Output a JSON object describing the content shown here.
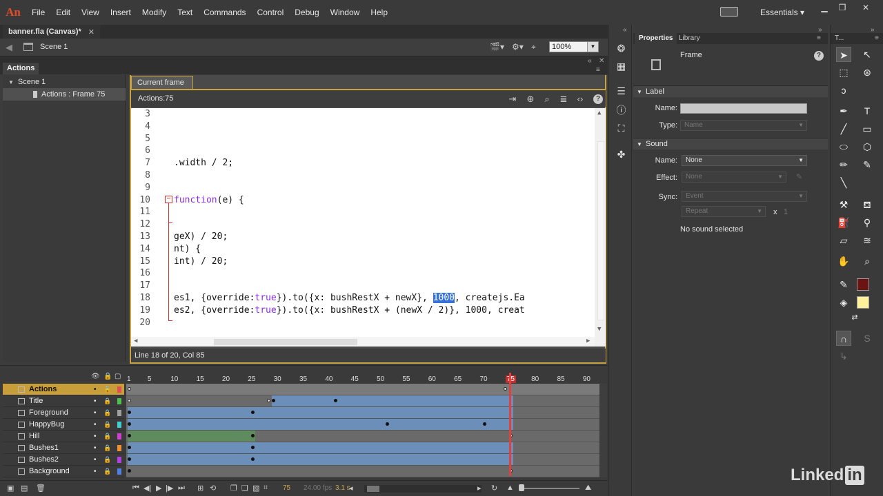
{
  "app": {
    "logo": "An"
  },
  "menu": [
    "File",
    "Edit",
    "View",
    "Insert",
    "Modify",
    "Text",
    "Commands",
    "Control",
    "Debug",
    "Window",
    "Help"
  ],
  "workspace": {
    "label": "Essentials"
  },
  "document": {
    "tab_title": "banner.fla (Canvas)*",
    "scene": "Scene 1",
    "zoom": "100%"
  },
  "actions_panel": {
    "tab_title": "Actions",
    "nav": {
      "scene": "Scene 1",
      "frame": "Actions : Frame 75"
    },
    "editor_tab": "Current frame",
    "editor_label": "Actions:75",
    "status": "Line 18 of 20, Col 85",
    "code_lines": [
      {
        "num": "3",
        "text": ""
      },
      {
        "num": "4",
        "text": ""
      },
      {
        "num": "5",
        "text": ""
      },
      {
        "num": "6",
        "text": ""
      },
      {
        "num": "7",
        "text": ".width / 2;"
      },
      {
        "num": "8",
        "text": ""
      },
      {
        "num": "9",
        "text": ""
      },
      {
        "num": "10",
        "kw": "function",
        "rest": "(e) {"
      },
      {
        "num": "11",
        "text": ""
      },
      {
        "num": "12",
        "text": ""
      },
      {
        "num": "13",
        "text": "geX) / 20;"
      },
      {
        "num": "14",
        "text": "nt) {"
      },
      {
        "num": "15",
        "text": "int) / 20;"
      },
      {
        "num": "16",
        "text": ""
      },
      {
        "num": "17",
        "text": ""
      },
      {
        "num": "18",
        "pre": "es1, {override:",
        "kw": "true",
        "mid": "}).to({x: bushRestX + newX}, ",
        "sel": "1000",
        "post": ", createjs.Ea"
      },
      {
        "num": "19",
        "pre": "es2, {override:",
        "kw": "true",
        "mid": "}).to({x: bushRestX + (newX / 2)}, 1000, creat",
        "sel": "",
        "post": ""
      },
      {
        "num": "20",
        "text": ""
      }
    ]
  },
  "properties": {
    "tabs": [
      "Properties",
      "Library"
    ],
    "object_type": "Frame",
    "label_section": "Label",
    "name_label": "Name:",
    "type_label": "Type:",
    "type_value": "Name",
    "sound_section": "Sound",
    "sound_name_label": "Name:",
    "sound_name_value": "None",
    "effect_label": "Effect:",
    "effect_value": "None",
    "sync_label": "Sync:",
    "sync_value": "Event",
    "repeat_value": "Repeat",
    "repeat_x": "x",
    "repeat_count": "1",
    "no_sound": "No sound selected"
  },
  "tools_header": "T...",
  "timeline": {
    "ruler": [
      "1",
      "5",
      "10",
      "15",
      "20",
      "25",
      "30",
      "35",
      "40",
      "45",
      "50",
      "55",
      "60",
      "65",
      "70",
      "75",
      "80",
      "85",
      "90"
    ],
    "current_frame": "75",
    "layers": [
      {
        "name": "Actions",
        "color": "#e05050",
        "active": true
      },
      {
        "name": "Title",
        "color": "#4fbf4f"
      },
      {
        "name": "Foreground",
        "color": "#a0a0a0"
      },
      {
        "name": "HappyBug",
        "color": "#3fcfcf"
      },
      {
        "name": "Hill",
        "color": "#d040d0"
      },
      {
        "name": "Bushes1",
        "color": "#f09030"
      },
      {
        "name": "Bushes2",
        "color": "#b040e0"
      },
      {
        "name": "Background",
        "color": "#5080e0"
      }
    ],
    "footer": {
      "frame": "75",
      "fps": "24.00 fps",
      "time": "3.1 s"
    }
  },
  "watermark": {
    "text": "Linked",
    "badge": "in"
  }
}
